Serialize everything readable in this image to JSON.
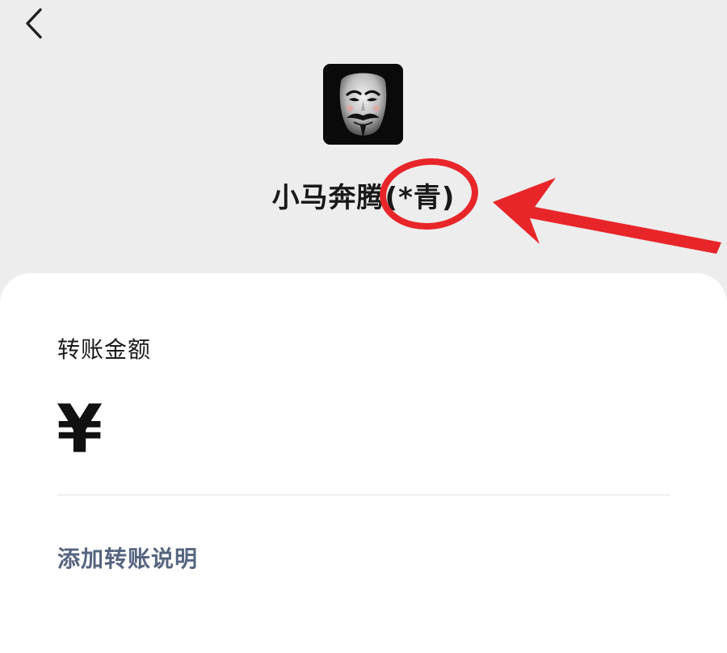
{
  "header": {
    "back_icon": "chevron-left-icon"
  },
  "recipient": {
    "avatar": "guy-fawkes-mask-avatar",
    "name": "小马奔腾(*青)"
  },
  "transfer": {
    "amount_label": "转账金额",
    "currency_symbol": "¥",
    "add_note_label": "添加转账说明"
  },
  "annotation": {
    "color": "#E8262A",
    "shapes": [
      "circle-highlight",
      "arrow-pointer"
    ]
  },
  "colors": {
    "background": "#EDEDED",
    "panel": "#FFFFFF",
    "link": "#56657F"
  }
}
